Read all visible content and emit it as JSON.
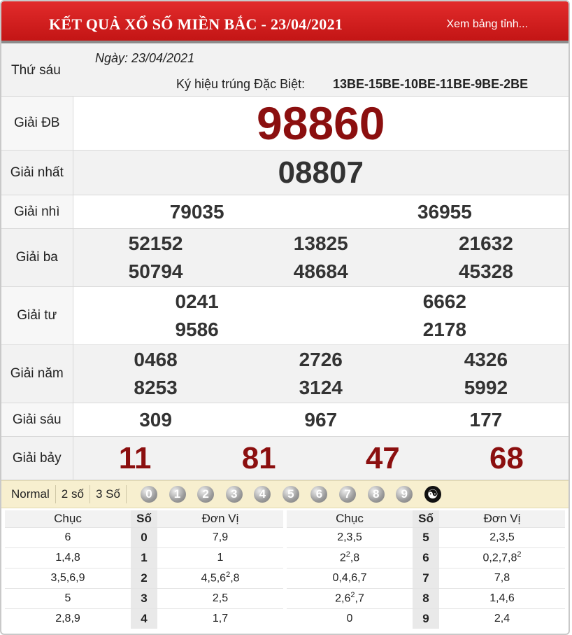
{
  "header": {
    "title": "KẾT QUẢ XỔ SỐ MIỀN BẮC - 23/04/2021",
    "link": "Xem bảng tỉnh..."
  },
  "meta": {
    "day": "Thứ sáu",
    "date": "Ngày: 23/04/2021",
    "code_label": "Ký hiệu trúng Đặc Biệt:",
    "code_value": "13BE-15BE-10BE-11BE-9BE-2BE"
  },
  "prizes": {
    "db": {
      "label": "Giải ĐB",
      "numbers": [
        "98860"
      ]
    },
    "g1": {
      "label": "Giải nhất",
      "numbers": [
        "08807"
      ]
    },
    "g2": {
      "label": "Giải nhì",
      "numbers": [
        "79035",
        "36955"
      ]
    },
    "g3": {
      "label": "Giải ba",
      "numbers": [
        "52152",
        "13825",
        "21632",
        "50794",
        "48684",
        "45328"
      ]
    },
    "g4": {
      "label": "Giải tư",
      "numbers": [
        "0241",
        "6662",
        "9586",
        "2178"
      ]
    },
    "g5": {
      "label": "Giải năm",
      "numbers": [
        "0468",
        "2726",
        "4326",
        "8253",
        "3124",
        "5992"
      ]
    },
    "g6": {
      "label": "Giải sáu",
      "numbers": [
        "309",
        "967",
        "177"
      ]
    },
    "g7": {
      "label": "Giải bảy",
      "numbers": [
        "11",
        "81",
        "47",
        "68"
      ]
    }
  },
  "filter": {
    "options": [
      "Normal",
      "2 số",
      "3 Số"
    ],
    "digits": [
      "0",
      "1",
      "2",
      "3",
      "4",
      "5",
      "6",
      "7",
      "8",
      "9"
    ],
    "yinyang": "☯"
  },
  "stats": {
    "headers": {
      "chuc": "Chục",
      "so": "Số",
      "dv": "Đơn Vị"
    },
    "left": [
      {
        "chuc": "6",
        "so": "0",
        "dv": "7,9"
      },
      {
        "chuc": "1,4,8",
        "so": "1",
        "dv": "1"
      },
      {
        "chuc": "3,5,6,9",
        "so": "2",
        "dv_pre": "4,5,6",
        "dv_sup": "2",
        "dv_post": ",8"
      },
      {
        "chuc": "5",
        "so": "3",
        "dv": "2,5"
      },
      {
        "chuc": "2,8,9",
        "so": "4",
        "dv": "1,7"
      }
    ],
    "right": [
      {
        "chuc": "2,3,5",
        "so": "5",
        "dv": "2,3,5"
      },
      {
        "chuc_pre": "2",
        "chuc_sup": "2",
        "chuc_post": ",8",
        "so": "6",
        "dv_pre": "0,2,7,8",
        "dv_sup": "2",
        "dv_post": ""
      },
      {
        "chuc": "0,4,6,7",
        "so": "7",
        "dv": "7,8"
      },
      {
        "chuc_pre": "2,6",
        "chuc_sup": "2",
        "chuc_post": ",7",
        "so": "8",
        "dv": "1,4,6"
      },
      {
        "chuc": "0",
        "so": "9",
        "dv": "2,4"
      }
    ]
  },
  "colors": {
    "header_red": "#d21f1f",
    "number_red": "#8b0f0f",
    "filter_bg": "#f7efcf"
  }
}
